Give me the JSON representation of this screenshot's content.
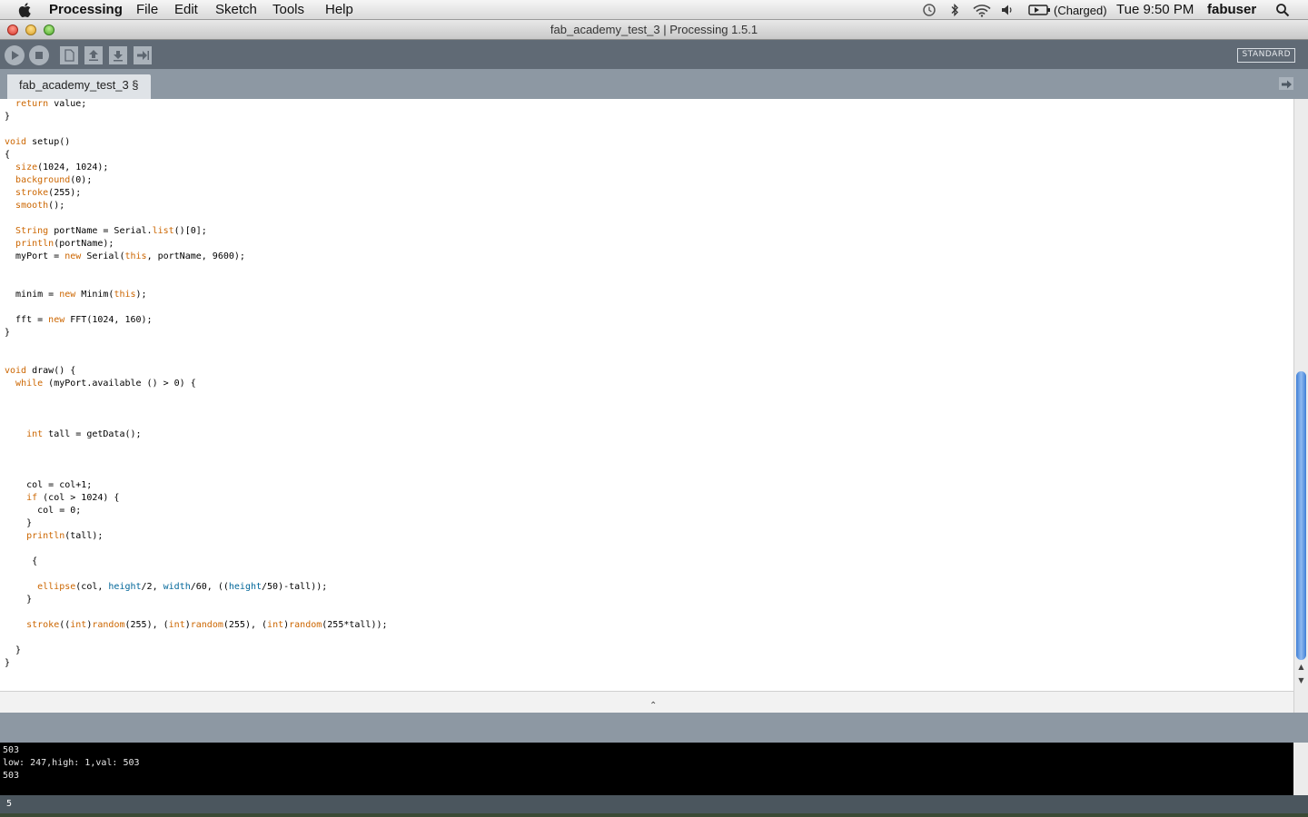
{
  "menubar": {
    "app_name": "Processing",
    "menus": [
      "File",
      "Edit",
      "Sketch",
      "Tools",
      "Help"
    ],
    "battery_status": "(Charged)",
    "clock": "Tue 9:50 PM",
    "user": "fabuser",
    "icons": [
      "apple-icon",
      "time-machine-icon",
      "bluetooth-icon",
      "wifi-icon",
      "volume-icon",
      "battery-icon",
      "spotlight-icon"
    ]
  },
  "window": {
    "title": "fab_academy_test_3 | Processing 1.5.1"
  },
  "toolbar": {
    "buttons": [
      "run",
      "stop",
      "new",
      "open",
      "save",
      "export"
    ],
    "mode_label": "STANDARD"
  },
  "tabs": [
    {
      "label": "fab_academy_test_3 §"
    }
  ],
  "editor": {
    "lines": [
      "  return value;",
      "}",
      "",
      "void setup()",
      "{",
      "  size(1024, 1024);",
      "  background(0);",
      "  stroke(255);",
      "  smooth();",
      "",
      "  String portName = Serial.list()[0];",
      "  println(portName);",
      "  myPort = new Serial(this, portName, 9600);",
      "",
      "",
      "  minim = new Minim(this);",
      "",
      "  fft = new FFT(1024, 160);",
      "}",
      "",
      "",
      "void draw() {",
      "  while (myPort.available () > 0) {",
      "",
      "",
      "",
      "    int tall = getData();",
      "",
      "",
      "",
      "    col = col+1;",
      "    if (col > 1024) {",
      "      col = 0;",
      "    }",
      "    println(tall);",
      "",
      "     {",
      "",
      "      ellipse(col, height/2, width/60, ((height/50)-tall));",
      "    }",
      "",
      "    stroke((int)random(255), (int)random(255), (int)random(255*tall));",
      "",
      "  }",
      "}"
    ]
  },
  "console": {
    "lines": [
      "503",
      "low: 247,high: 1,val: 503",
      "503"
    ]
  },
  "status": {
    "line_number": "5"
  }
}
